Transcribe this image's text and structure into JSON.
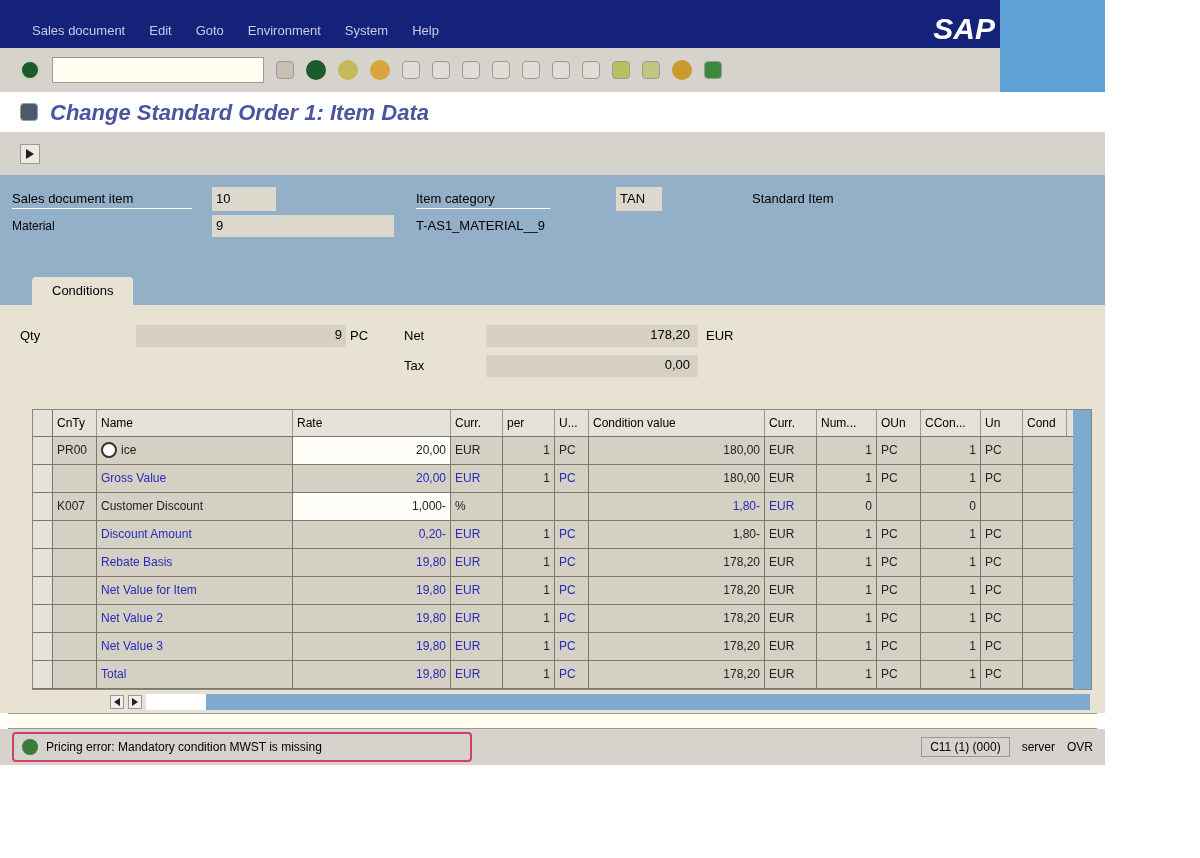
{
  "menu": [
    "Sales document",
    "Edit",
    "Goto",
    "Environment",
    "System",
    "Help"
  ],
  "logo": "SAP",
  "title": "Change Standard Order 1: Item Data",
  "header": {
    "sales_document_item": {
      "label": "Sales document item",
      "value": "10"
    },
    "item_category": {
      "label": "Item category",
      "value": "TAN",
      "text": "Standard Item"
    },
    "material": {
      "label": "Material",
      "value": "9",
      "text": "T-AS1_MATERIAL__9"
    }
  },
  "tabs": [
    {
      "label": "Conditions",
      "selected": true
    }
  ],
  "totals": {
    "qty": {
      "label": "Qty",
      "value": "9",
      "unit": "PC"
    },
    "net": {
      "label": "Net",
      "value": "178,20",
      "unit": "EUR"
    },
    "tax": {
      "label": "Tax",
      "value": "0,00"
    }
  },
  "table": {
    "columns": [
      "CnTy",
      "Name",
      "Rate",
      "Curr.",
      "per",
      "U...",
      "Condition value",
      "Curr.",
      "Num...",
      "OUn",
      "CCon...",
      "Un",
      "Cond"
    ],
    "rows": [
      {
        "kind": "condition",
        "cells": [
          "PR00",
          "ice",
          "20,00",
          "EUR",
          "1",
          "PC",
          "180,00",
          "EUR",
          "1",
          "PC",
          "1",
          "PC"
        ]
      },
      {
        "kind": "subtotal",
        "cells": [
          "",
          "Gross Value",
          "20,00",
          "EUR",
          "1",
          "PC",
          "180,00",
          "EUR",
          "1",
          "PC",
          "1",
          "PC"
        ]
      },
      {
        "kind": "condition",
        "cells": [
          "K007",
          "Customer Discount",
          "1,000-",
          "%",
          "",
          "",
          "1,80-",
          "EUR",
          "0",
          "",
          "0",
          ""
        ]
      },
      {
        "kind": "subtotal",
        "cells": [
          "",
          "Discount Amount",
          "0,20-",
          "EUR",
          "1",
          "PC",
          "1,80-",
          "EUR",
          "1",
          "PC",
          "1",
          "PC"
        ]
      },
      {
        "kind": "subtotal",
        "cells": [
          "",
          "Rebate Basis",
          "19,80",
          "EUR",
          "1",
          "PC",
          "178,20",
          "EUR",
          "1",
          "PC",
          "1",
          "PC"
        ]
      },
      {
        "kind": "subtotal",
        "cells": [
          "",
          "Net Value for Item",
          "19,80",
          "EUR",
          "1",
          "PC",
          "178,20",
          "EUR",
          "1",
          "PC",
          "1",
          "PC"
        ]
      },
      {
        "kind": "subtotal",
        "cells": [
          "",
          "Net Value 2",
          "19,80",
          "EUR",
          "1",
          "PC",
          "178,20",
          "EUR",
          "1",
          "PC",
          "1",
          "PC"
        ]
      },
      {
        "kind": "subtotal",
        "cells": [
          "",
          "Net Value 3",
          "19,80",
          "EUR",
          "1",
          "PC",
          "178,20",
          "EUR",
          "1",
          "PC",
          "1",
          "PC"
        ]
      },
      {
        "kind": "subtotal",
        "cells": [
          "",
          "Total",
          "19,80",
          "EUR",
          "1",
          "PC",
          "178,20",
          "EUR",
          "1",
          "PC",
          "1",
          "PC"
        ]
      }
    ]
  },
  "status_bar": {
    "message": "Pricing error: Mandatory condition MWST is missing",
    "system": "C11 (1) (000)",
    "server": "server",
    "mode": "OVR"
  }
}
